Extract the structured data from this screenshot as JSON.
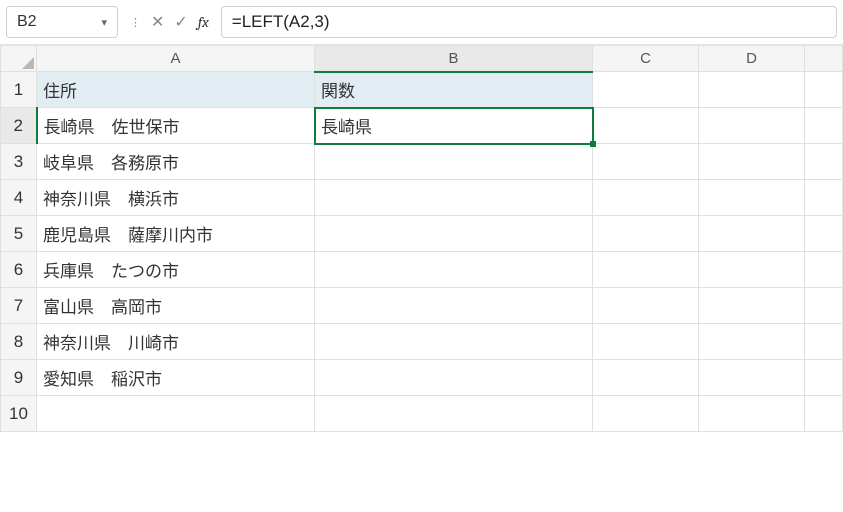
{
  "nameBox": {
    "value": "B2"
  },
  "formulaBar": {
    "value": "=LEFT(A2,3)"
  },
  "columns": [
    "A",
    "B",
    "C",
    "D"
  ],
  "headerRow": {
    "A": "住所",
    "B": "関数"
  },
  "selectedCell": "B2",
  "data": {
    "A": {
      "2": "長崎県　佐世保市",
      "3": "岐阜県　各務原市",
      "4": "神奈川県　横浜市",
      "5": "鹿児島県　薩摩川内市",
      "6": "兵庫県　たつの市",
      "7": "富山県　高岡市",
      "8": "神奈川県　川崎市",
      "9": "愛知県　稲沢市"
    },
    "B": {
      "2": "長崎県"
    }
  },
  "visibleRows": 10
}
